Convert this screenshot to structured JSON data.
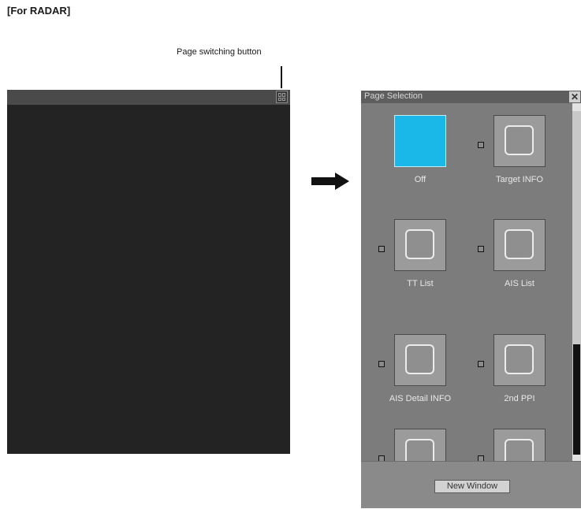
{
  "heading": "[For RADAR]",
  "callout": {
    "label": "Page switching button"
  },
  "radar_panel": {
    "page_button_icon": "page-grid-icon"
  },
  "arrow_icon": "right-arrow-icon",
  "dialog": {
    "title": "Page Selection",
    "close_icon": "close-icon",
    "items": [
      {
        "label": "Off",
        "selected": true,
        "show_indicator": false
      },
      {
        "label": "Target INFO",
        "selected": false,
        "show_indicator": true
      },
      {
        "label": "TT List",
        "selected": false,
        "show_indicator": true
      },
      {
        "label": "AIS List",
        "selected": false,
        "show_indicator": true
      },
      {
        "label": "AIS Detail INFO",
        "selected": false,
        "show_indicator": true
      },
      {
        "label": "2nd PPI",
        "selected": false,
        "show_indicator": true
      },
      {
        "label": "",
        "selected": false,
        "show_indicator": true
      },
      {
        "label": "",
        "selected": false,
        "show_indicator": true
      }
    ],
    "new_window_label": "New Window"
  },
  "colors": {
    "selected_tile": "#1ab8e8",
    "panel_bg": "#232323",
    "dialog_bg": "#7c7c7c"
  }
}
